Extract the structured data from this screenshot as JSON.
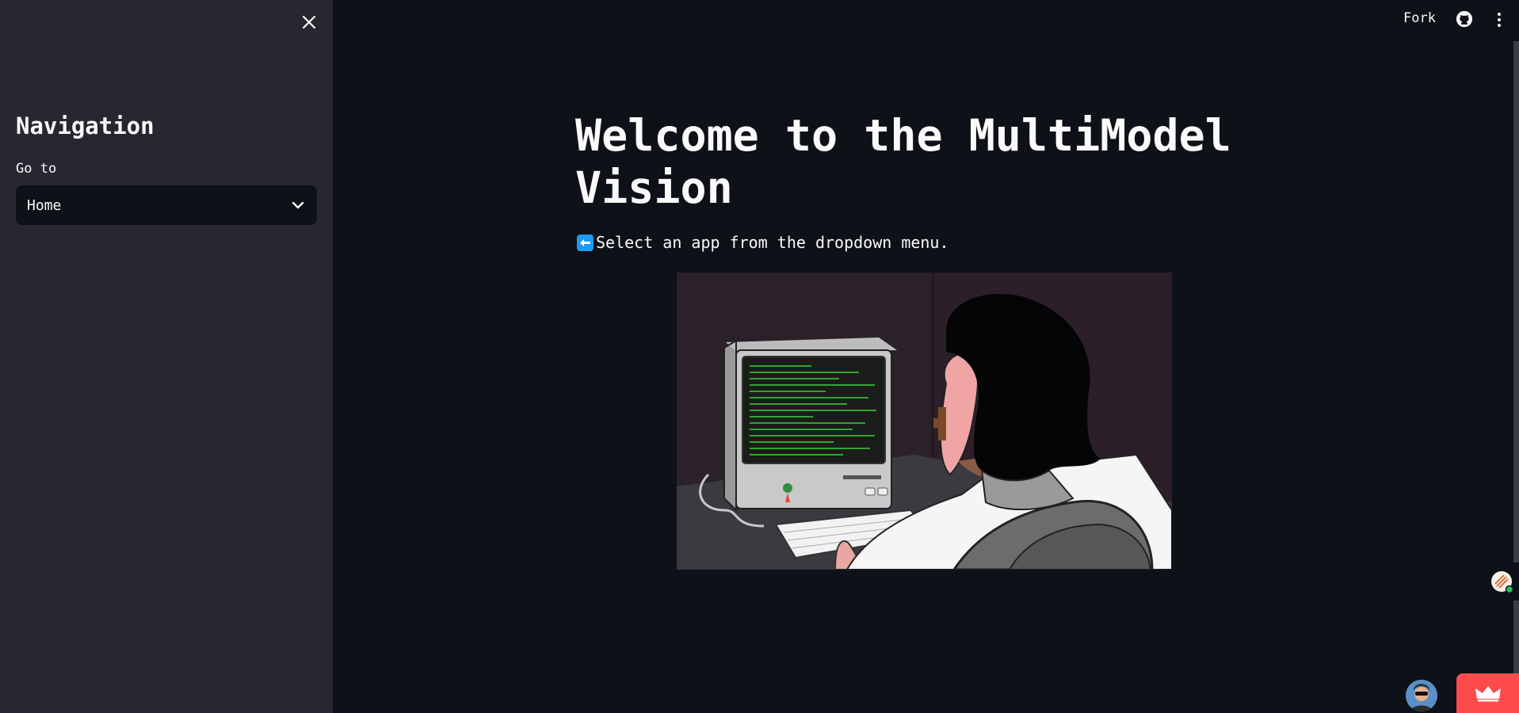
{
  "sidebar": {
    "title": "Navigation",
    "select_label": "Go to",
    "select_value": "Home"
  },
  "header": {
    "fork_label": "Fork"
  },
  "main": {
    "title": "Welcome to the MultiModel Vision",
    "intro_text": "Select an app from the dropdown menu."
  },
  "icons": {
    "close": "close-icon",
    "chevron": "chevron-down-icon",
    "github": "github-icon",
    "menu": "vertical-dots-icon",
    "arrow": "left-arrow-icon",
    "crown": "crown-icon"
  },
  "colors": {
    "background": "#0e1117",
    "sidebar": "#262730",
    "accent_red": "#ff4b4b",
    "arrow_blue": "#1d9bf0",
    "terminal_green": "#3cd13c"
  }
}
